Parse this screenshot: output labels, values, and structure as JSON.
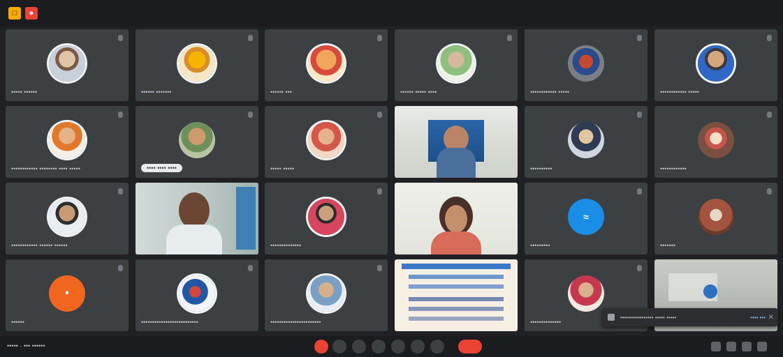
{
  "topbar": {
    "icon1": "app-icon",
    "icon2": "record-icon"
  },
  "meeting": {
    "info": "••••• · ••• ••••••"
  },
  "tiles": [
    {
      "name": "••••• ••••••"
    },
    {
      "name": "•••••• •••••••"
    },
    {
      "name": "•••••• •••"
    },
    {
      "name": "•••••• ••••• ••••"
    },
    {
      "name": "•••••••••••• •••••"
    },
    {
      "name": "•••••••••••• •••••"
    },
    {
      "name": "•••••••••••• •••••••• •••• •••••"
    },
    {
      "name": "•••• •••• ••••"
    },
    {
      "name": "••••• •••••"
    },
    {
      "name": ""
    },
    {
      "name": "••••••••••"
    },
    {
      "name": "••••••••••••"
    },
    {
      "name": "•••••••••••• •••••• ••••••"
    },
    {
      "name": ""
    },
    {
      "name": "••••••••••••••"
    },
    {
      "name": ""
    },
    {
      "name": "•••••••••"
    },
    {
      "name": "•••••••"
    },
    {
      "name": "••••••"
    },
    {
      "name": "••••••••••••••••••••••••••"
    },
    {
      "name": "•••••••••••••••••••••••"
    },
    {
      "name": ""
    },
    {
      "name": "••••••••••••••"
    },
    {
      "name": ""
    }
  ],
  "toast": {
    "text": "••••••••••••••••• ••••• •••••",
    "action": "•••• •••"
  }
}
